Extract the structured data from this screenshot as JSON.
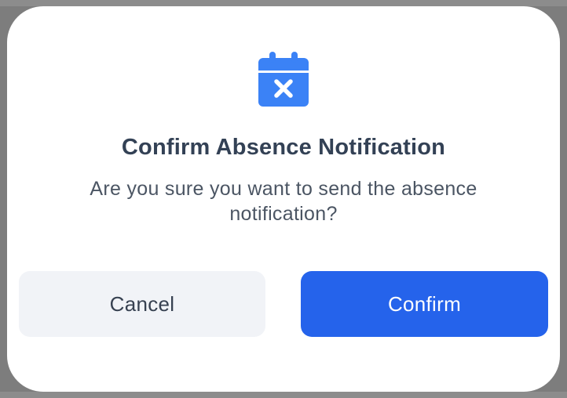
{
  "dialog": {
    "icon": "calendar-x-icon",
    "title": "Confirm Absence Notification",
    "message": "Are you sure you want to send the absence notification?",
    "cancel_label": "Cancel",
    "confirm_label": "Confirm"
  },
  "colors": {
    "accent": "#2563eb",
    "icon": "#3b82f6",
    "title": "#334155",
    "message": "#4b5563",
    "cancel_bg": "#f1f3f7"
  }
}
